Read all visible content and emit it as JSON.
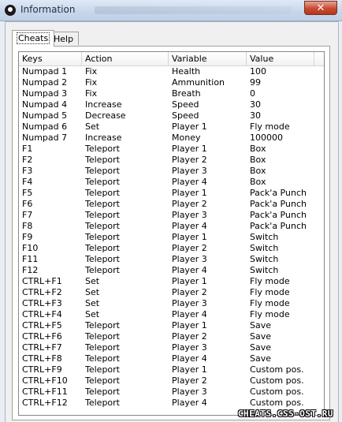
{
  "window": {
    "title": "Information",
    "close_label": "✕"
  },
  "tabs": [
    {
      "label": "Cheats",
      "active": true
    },
    {
      "label": "Help",
      "active": false
    }
  ],
  "table": {
    "columns": [
      "Keys",
      "Action",
      "Variable",
      "Value"
    ],
    "rows": [
      [
        "Numpad 1",
        "Fix",
        "Health",
        "100"
      ],
      [
        "Numpad 2",
        "Fix",
        "Ammunition",
        "99"
      ],
      [
        "Numpad 3",
        "Fix",
        "Breath",
        "0"
      ],
      [
        "Numpad 4",
        "Increase",
        "Speed",
        "30"
      ],
      [
        "Numpad 5",
        "Decrease",
        "Speed",
        "30"
      ],
      [
        "Numpad 6",
        "Set",
        "Player 1",
        "Fly mode"
      ],
      [
        "Numpad 7",
        "Increase",
        "Money",
        "100000"
      ],
      [
        "F1",
        "Teleport",
        "Player 1",
        "Box"
      ],
      [
        "F2",
        "Teleport",
        "Player 2",
        "Box"
      ],
      [
        "F3",
        "Teleport",
        "Player 3",
        "Box"
      ],
      [
        "F4",
        "Teleport",
        "Player 4",
        "Box"
      ],
      [
        "F5",
        "Teleport",
        "Player 1",
        "Pack'a Punch"
      ],
      [
        "F6",
        "Teleport",
        "Player 2",
        "Pack'a Punch"
      ],
      [
        "F7",
        "Teleport",
        "Player 3",
        "Pack'a Punch"
      ],
      [
        "F8",
        "Teleport",
        "Player 4",
        "Pack'a Punch"
      ],
      [
        "F9",
        "Teleport",
        "Player 1",
        "Switch"
      ],
      [
        "F10",
        "Teleport",
        "Player 2",
        "Switch"
      ],
      [
        "F11",
        "Teleport",
        "Player 3",
        "Switch"
      ],
      [
        "F12",
        "Teleport",
        "Player 4",
        "Switch"
      ],
      [
        "CTRL+F1",
        "Set",
        "Player 1",
        "Fly mode"
      ],
      [
        "CTRL+F2",
        "Set",
        "Player 2",
        "Fly mode"
      ],
      [
        "CTRL+F3",
        "Set",
        "Player 3",
        "Fly mode"
      ],
      [
        "CTRL+F4",
        "Set",
        "Player 4",
        "Fly mode"
      ],
      [
        "CTRL+F5",
        "Teleport",
        "Player 1",
        "Save"
      ],
      [
        "CTRL+F6",
        "Teleport",
        "Player 2",
        "Save"
      ],
      [
        "CTRL+F7",
        "Teleport",
        "Player 3",
        "Save"
      ],
      [
        "CTRL+F8",
        "Teleport",
        "Player 4",
        "Save"
      ],
      [
        "CTRL+F9",
        "Teleport",
        "Player 1",
        "Custom pos."
      ],
      [
        "CTRL+F10",
        "Teleport",
        "Player 2",
        "Custom pos."
      ],
      [
        "CTRL+F11",
        "Teleport",
        "Player 3",
        "Custom pos."
      ],
      [
        "CTRL+F12",
        "Teleport",
        "Player 4",
        "Custom pos."
      ]
    ]
  },
  "watermark": "CHEATS.CSS-OST.RU",
  "icons": {
    "app": "bomb-icon",
    "close": "close-icon"
  }
}
